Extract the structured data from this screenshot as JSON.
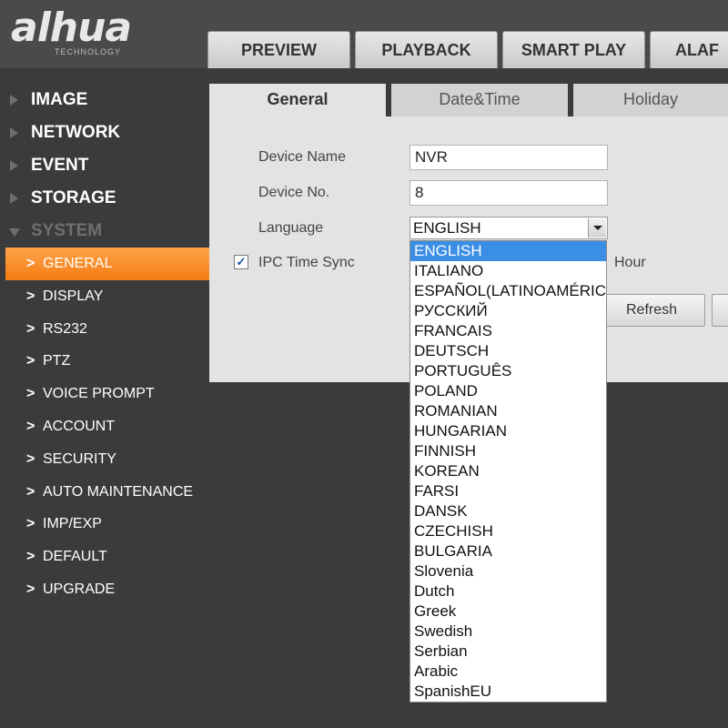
{
  "header": {
    "logo_text": "alhua",
    "logo_sub": "TECHNOLOGY",
    "tabs": [
      "PREVIEW",
      "PLAYBACK",
      "SMART PLAY",
      "ALAF"
    ]
  },
  "sidebar": {
    "categories": [
      "IMAGE",
      "NETWORK",
      "EVENT",
      "STORAGE",
      "SYSTEM"
    ],
    "system_items": [
      "GENERAL",
      "DISPLAY",
      "RS232",
      "PTZ",
      "VOICE PROMPT",
      "ACCOUNT",
      "SECURITY",
      "AUTO MAINTENANCE",
      "IMP/EXP",
      "DEFAULT",
      "UPGRADE"
    ],
    "chevron": ">"
  },
  "panel": {
    "tabs": [
      "General",
      "Date&Time",
      "Holiday"
    ],
    "device_name_label": "Device Name",
    "device_name_value": "NVR",
    "device_no_label": "Device No.",
    "device_no_value": "8",
    "language_label": "Language",
    "language_value": "ENGLISH",
    "ipc_time_sync_label": "IPC Time Sync",
    "ipc_time_sync_checked": true,
    "check_mark": "✓",
    "hour_label": "Hour",
    "refresh_label": "Refresh"
  },
  "language_options": [
    "ENGLISH",
    "ITALIANO",
    "ESPAÑOL(LATINOAMÉRIC",
    "РУССКИЙ",
    "FRANCAIS",
    "DEUTSCH",
    "PORTUGUÊS",
    "POLAND",
    "ROMANIAN",
    "HUNGARIAN",
    "FINNISH",
    "KOREAN",
    "FARSI",
    "DANSK",
    "CZECHISH",
    "BULGARIA",
    "Slovenia",
    "Dutch",
    "Greek",
    "Swedish",
    "Serbian",
    "Arabic",
    "SpanishEU"
  ],
  "colors": {
    "background": "#3b3b3b",
    "active_menu": "#f47d12",
    "selected_option": "#3a8ee6",
    "panel": "#e3e3e3"
  }
}
